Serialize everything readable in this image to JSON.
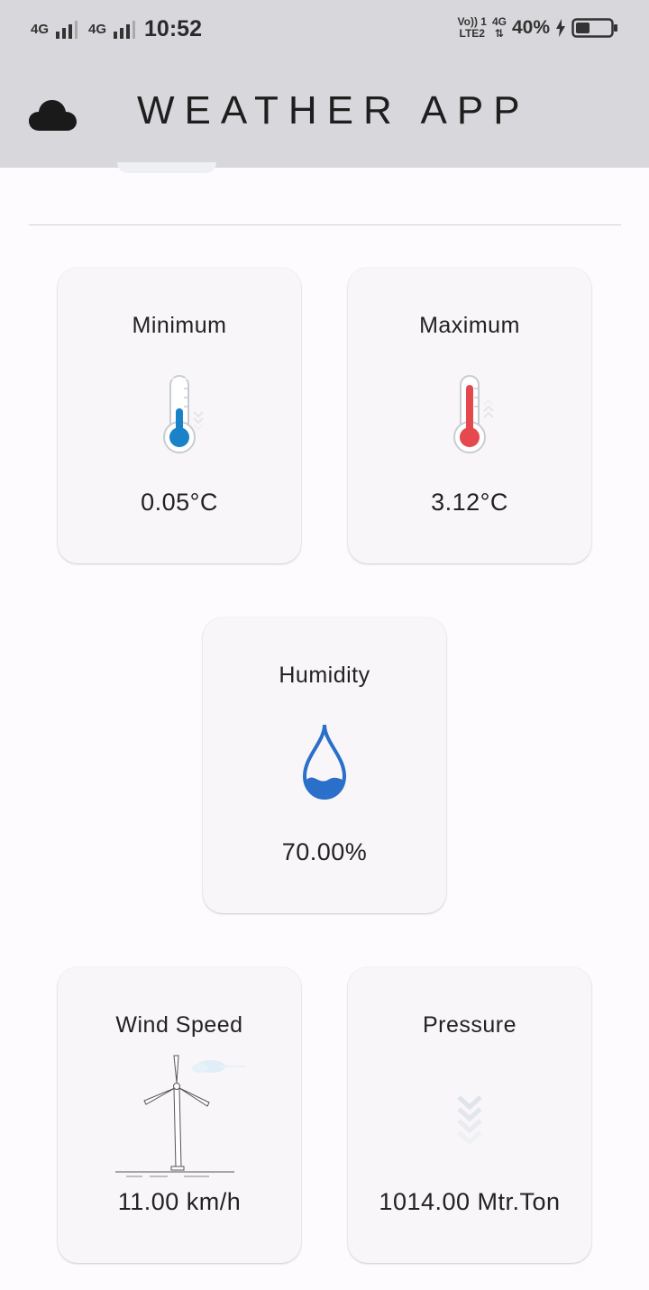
{
  "status_bar": {
    "sim1_network": "4G",
    "sim2_network": "4G",
    "time": "10:52",
    "volte_label": "Vo)) 1",
    "lte_label": "LTE2",
    "data_network": "4G",
    "battery_percent": "40%"
  },
  "app_bar": {
    "title": "WEATHER APP",
    "icon": "cloud-icon"
  },
  "cards": {
    "minimum": {
      "label": "Minimum",
      "value": "0.05°C",
      "icon": "thermometer-cold-icon",
      "color": "#1a82c6"
    },
    "maximum": {
      "label": "Maximum",
      "value": "3.12°C",
      "icon": "thermometer-hot-icon",
      "color": "#e5484d"
    },
    "humidity": {
      "label": "Humidity",
      "value": "70.00%",
      "icon": "water-drop-icon",
      "color": "#2a6fc9"
    },
    "wind_speed": {
      "label": "Wind Speed",
      "value": "11.00 km/h",
      "icon": "wind-turbine-icon"
    },
    "pressure": {
      "label": "Pressure",
      "value": "1014.00 Mtr.Ton",
      "icon": "chevrons-down-icon"
    }
  }
}
